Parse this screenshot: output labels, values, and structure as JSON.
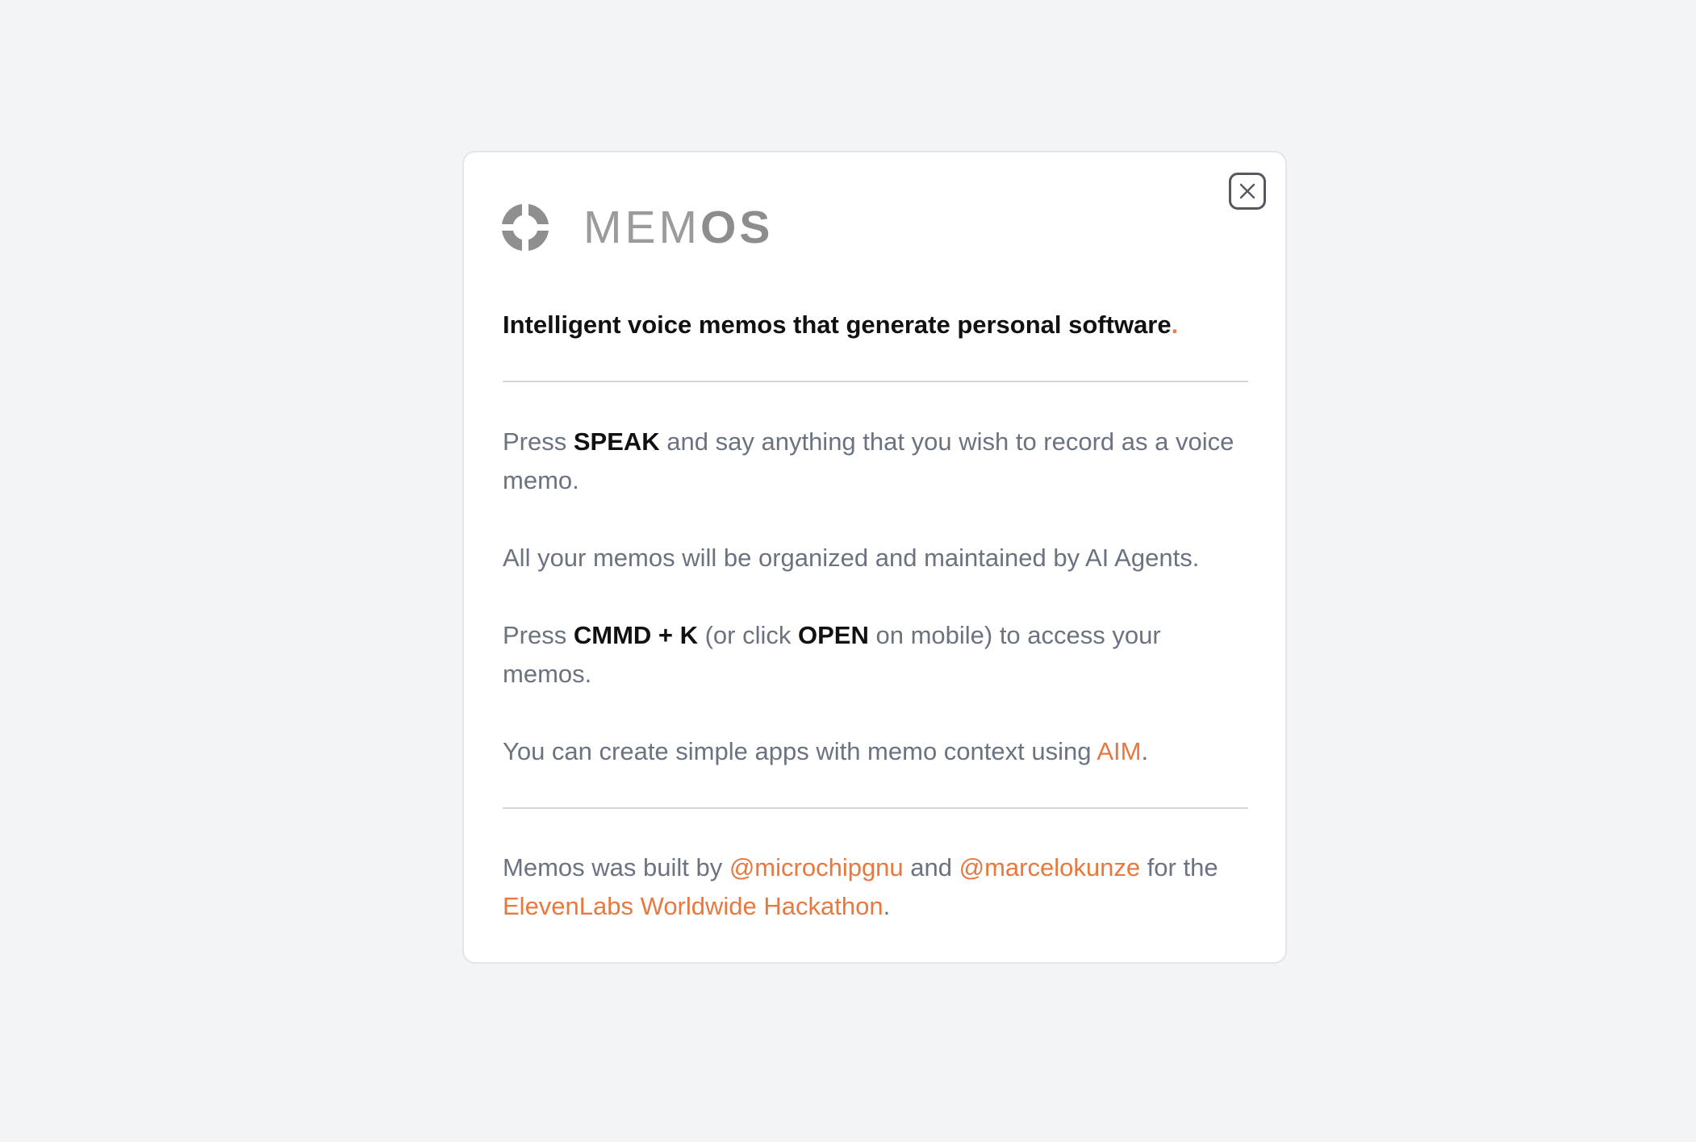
{
  "modal": {
    "close_label": "Close",
    "logo": {
      "icon": "memos-logo-icon",
      "text_light": "MEM",
      "text_bold": "OS"
    },
    "tagline": {
      "text": "Intelligent voice memos that generate personal software",
      "dot": "."
    },
    "instructions": {
      "p1": {
        "before": "Press ",
        "key": "SPEAK",
        "after": " and say anything that you wish to record as a voice memo."
      },
      "p2": "All your memos will be organized and maintained by AI Agents.",
      "p3": {
        "before": "Press ",
        "shortcut": "CMMD + K",
        "middle": " (or click ",
        "button": "OPEN",
        "after": " on mobile) to access your memos."
      },
      "p4": {
        "before": "You can create simple apps with memo context using ",
        "link": "AIM",
        "after": "."
      }
    },
    "credits": {
      "before": "Memos was built by ",
      "author1": "@microchipgnu",
      "and": " and ",
      "author2": "@marcelokunze",
      "middle": " for the ",
      "event": "ElevenLabs Worldwide Hackathon",
      "after": "."
    }
  },
  "colors": {
    "page_background": "#f3f4f6",
    "accent": "#e9783e",
    "body_text": "#6b7280",
    "heading_text": "#111111",
    "logo_gray": "#8d8d8d"
  }
}
